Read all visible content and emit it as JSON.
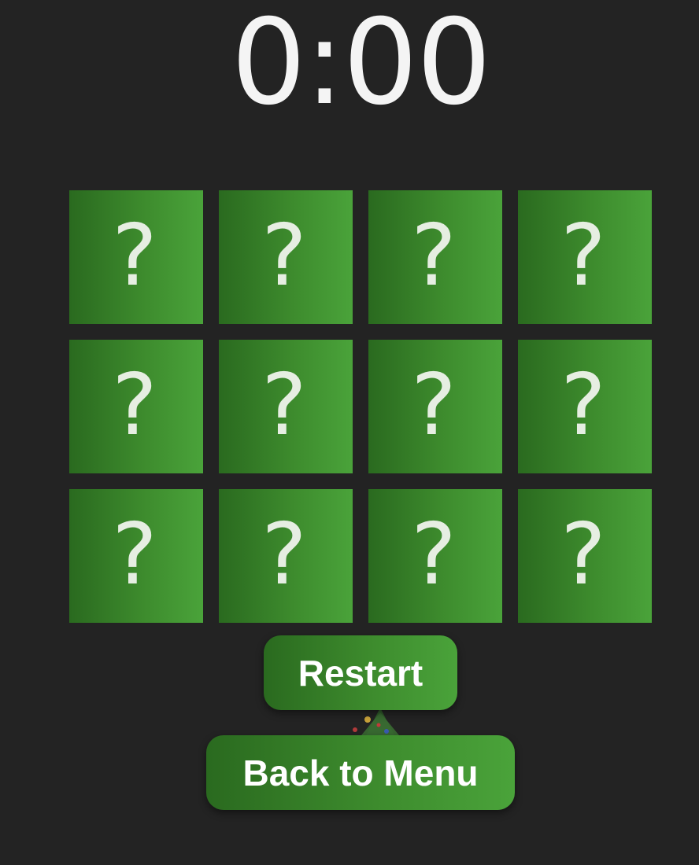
{
  "timer": {
    "display": "0:00"
  },
  "board": {
    "rows": 3,
    "columns": 4,
    "cards": [
      {
        "face": "?"
      },
      {
        "face": "?"
      },
      {
        "face": "?"
      },
      {
        "face": "?"
      },
      {
        "face": "?"
      },
      {
        "face": "?"
      },
      {
        "face": "?"
      },
      {
        "face": "?"
      },
      {
        "face": "?"
      },
      {
        "face": "?"
      },
      {
        "face": "?"
      },
      {
        "face": "?"
      }
    ]
  },
  "buttons": {
    "restart_label": "Restart",
    "menu_label": "Back to Menu"
  },
  "colors": {
    "background": "#232323",
    "card_green_dark": "#2a6a1f",
    "card_green_light": "#4aa33a",
    "text": "#ffffff"
  }
}
